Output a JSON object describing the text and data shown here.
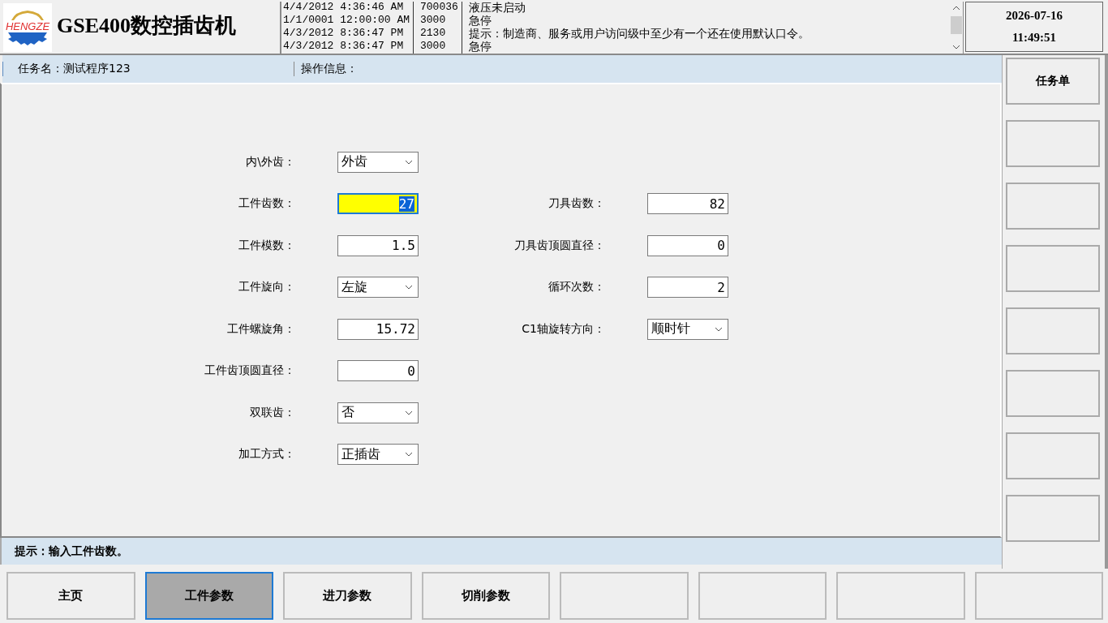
{
  "header": {
    "logo_text": "HENGZE",
    "title": "GSE400数控插齿机",
    "log": [
      {
        "time": "4/4/2012 4:36:46 AM",
        "code": "700036",
        "message": "液压未启动"
      },
      {
        "time": "1/1/0001 12:00:00 AM",
        "code": "3000",
        "message": "急停"
      },
      {
        "time": "4/3/2012 8:36:47 PM",
        "code": "2130",
        "message": "提示：制造商、服务或用户访问级中至少有一个还在使用默认口令。"
      },
      {
        "time": "4/3/2012 8:36:47 PM",
        "code": "3000",
        "message": "急停"
      }
    ],
    "date": "2026-07-16",
    "time": "11:49:51"
  },
  "task_bar": {
    "task_name": "任务名：测试程序123",
    "operation_info": "操作信息："
  },
  "form_rows": [
    {
      "left": {
        "label": "内\\外齿：",
        "kind": "select",
        "value": "外齿"
      }
    },
    {
      "left": {
        "label": "工件齿数：",
        "kind": "input",
        "value": "27",
        "selected": true
      },
      "right": {
        "label": "刀具齿数：",
        "kind": "input",
        "value": "82",
        "selected": false
      }
    },
    {
      "left": {
        "label": "工件模数：",
        "kind": "input",
        "value": "1.5",
        "selected": false
      },
      "right": {
        "label": "刀具齿顶圆直径：",
        "kind": "input",
        "value": "0",
        "selected": false
      }
    },
    {
      "left": {
        "label": "工件旋向：",
        "kind": "select",
        "value": "左旋"
      },
      "right": {
        "label": "循环次数：",
        "kind": "input",
        "value": "2",
        "selected": false
      }
    },
    {
      "left": {
        "label": "工件螺旋角：",
        "kind": "input",
        "value": "15.72",
        "selected": false
      },
      "right": {
        "label": "C1轴旋转方向：",
        "kind": "select",
        "value": "顺时针"
      }
    },
    {
      "left": {
        "label": "工件齿顶圆直径：",
        "kind": "input",
        "value": "0",
        "selected": false
      }
    },
    {
      "left": {
        "label": "双联齿：",
        "kind": "select",
        "value": "否"
      }
    },
    {
      "left": {
        "label": "加工方式：",
        "kind": "select",
        "value": "正插齿"
      }
    }
  ],
  "hint": "提示：输入工件齿数。",
  "side_buttons": [
    {
      "kind": "labeled",
      "label": "任务单"
    },
    {
      "kind": "blank"
    },
    {
      "kind": "blank"
    },
    {
      "kind": "blank"
    },
    {
      "kind": "blank"
    },
    {
      "kind": "blank"
    },
    {
      "kind": "blank"
    },
    {
      "kind": "blank"
    }
  ],
  "bottom_tabs": [
    {
      "kind": "labeled",
      "label": "主页",
      "selected": false
    },
    {
      "kind": "labeled",
      "label": "工件参数",
      "selected": true
    },
    {
      "kind": "labeled",
      "label": "进刀参数",
      "selected": false
    },
    {
      "kind": "labeled",
      "label": "切削参数",
      "selected": false
    },
    {
      "kind": "blank",
      "selected": false
    },
    {
      "kind": "blank",
      "selected": false
    },
    {
      "kind": "blank",
      "selected": false
    },
    {
      "kind": "blank",
      "selected": false
    }
  ]
}
